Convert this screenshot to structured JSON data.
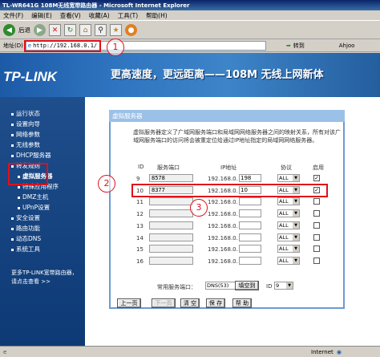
{
  "window": {
    "title": "TL-WR641G 108M无线宽带路由器 - Microsoft Internet Explorer"
  },
  "menu": [
    "文件(F)",
    "编辑(E)",
    "查看(V)",
    "收藏(A)",
    "工具(T)",
    "帮助(H)"
  ],
  "toolbar": {
    "back_label": "后退"
  },
  "address": {
    "label": "地址(D)",
    "url": "http://192.168.0.1/",
    "go_label": "转到",
    "links_label": "Ahjoo"
  },
  "banner": {
    "logo": "TP-LINK",
    "slogan": "更高速度，更远距离——108M 无线上网新体"
  },
  "sidebar": {
    "items": [
      "运行状态",
      "设置向导",
      "网络参数",
      "无线参数",
      "DHCP服务器",
      "转发规则",
      "虚拟服务器",
      "特殊应用程序",
      "DMZ主机",
      "UPnP设置",
      "安全设置",
      "路由功能",
      "动态DNS",
      "系统工具"
    ],
    "footer": "更多TP-LINK宽带路由器，请点击查看 >>"
  },
  "panel": {
    "title": "虚拟服务器",
    "description": "虚拟服务器定义了广域网服务端口和局域网网络服务器之间的映射关系，所有对该广域网服务端口的访问将会被重定位给通过IP地址指定的局域网网络服务器。",
    "headers": {
      "id": "ID",
      "port": "服务端口",
      "ip": "IP地址",
      "protocol": "协议",
      "enable": "启用"
    },
    "ip_prefix": "192.168.0.",
    "rows": [
      {
        "id": "9",
        "port": "8578",
        "ip": "198",
        "protocol": "ALL",
        "enabled": true
      },
      {
        "id": "10",
        "port": "8377",
        "ip": "10",
        "protocol": "ALL",
        "enabled": true
      },
      {
        "id": "11",
        "port": "",
        "ip": "",
        "protocol": "ALL",
        "enabled": false
      },
      {
        "id": "12",
        "port": "",
        "ip": "",
        "protocol": "ALL",
        "enabled": false
      },
      {
        "id": "13",
        "port": "",
        "ip": "",
        "protocol": "ALL",
        "enabled": false
      },
      {
        "id": "14",
        "port": "",
        "ip": "",
        "protocol": "ALL",
        "enabled": false
      },
      {
        "id": "15",
        "port": "",
        "ip": "",
        "protocol": "ALL",
        "enabled": false
      },
      {
        "id": "16",
        "port": "",
        "ip": "",
        "protocol": "ALL",
        "enabled": false
      }
    ],
    "common_port_label": "常用服务端口：",
    "common_port_value": "DNS(53)",
    "fill_to_label": "填空到",
    "fill_id_label": "ID",
    "fill_id_value": "9",
    "buttons": {
      "prev": "上一页",
      "next": "下一页",
      "clear": "清 空",
      "save": "保 存",
      "help": "帮 助"
    }
  },
  "annotations": [
    "1",
    "2",
    "3"
  ],
  "status": {
    "zone": "Internet"
  },
  "colors": {
    "accent": "#1f4e8c",
    "highlight": "#e0101a"
  }
}
